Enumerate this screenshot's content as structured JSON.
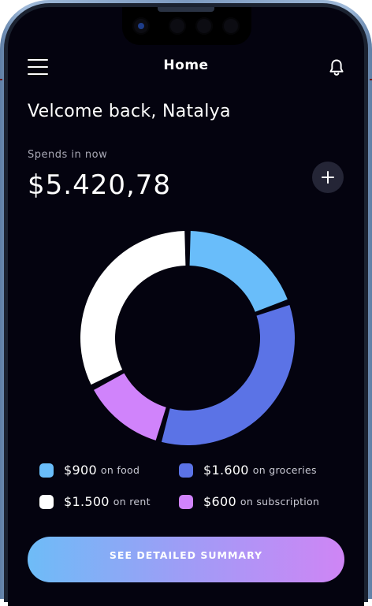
{
  "header": {
    "title": "Home",
    "menu_icon": "hamburger-menu-icon",
    "notification_icon": "bell-icon"
  },
  "greeting": "Velcome back, Natalya",
  "spends": {
    "label": "Spends in now",
    "amount": "$5.420,78",
    "add_icon": "plus-icon"
  },
  "chart_data": {
    "type": "pie",
    "variant": "donut",
    "categories": [
      "food",
      "groceries",
      "subscription",
      "rent"
    ],
    "values": [
      900,
      1600,
      600,
      1500
    ],
    "colors": [
      "#69bdfa",
      "#5b73e6",
      "#d083fb",
      "#ffffff"
    ]
  },
  "legend": [
    {
      "value": "$900",
      "suffix": "on food",
      "color": "#69bdfa"
    },
    {
      "value": "$1.600",
      "suffix": "on groceries",
      "color": "#5b73e6"
    },
    {
      "value": "$1.500",
      "suffix": "on rent",
      "color": "#ffffff"
    },
    {
      "value": "$600",
      "suffix": "on subscription",
      "color": "#d083fb"
    }
  ],
  "summary_button": {
    "label": "SEE DETAILED SUMMARY"
  },
  "theme": {
    "background": "#04030f",
    "accent_gradient": [
      "#6ebcf7",
      "#cf85f5"
    ]
  }
}
